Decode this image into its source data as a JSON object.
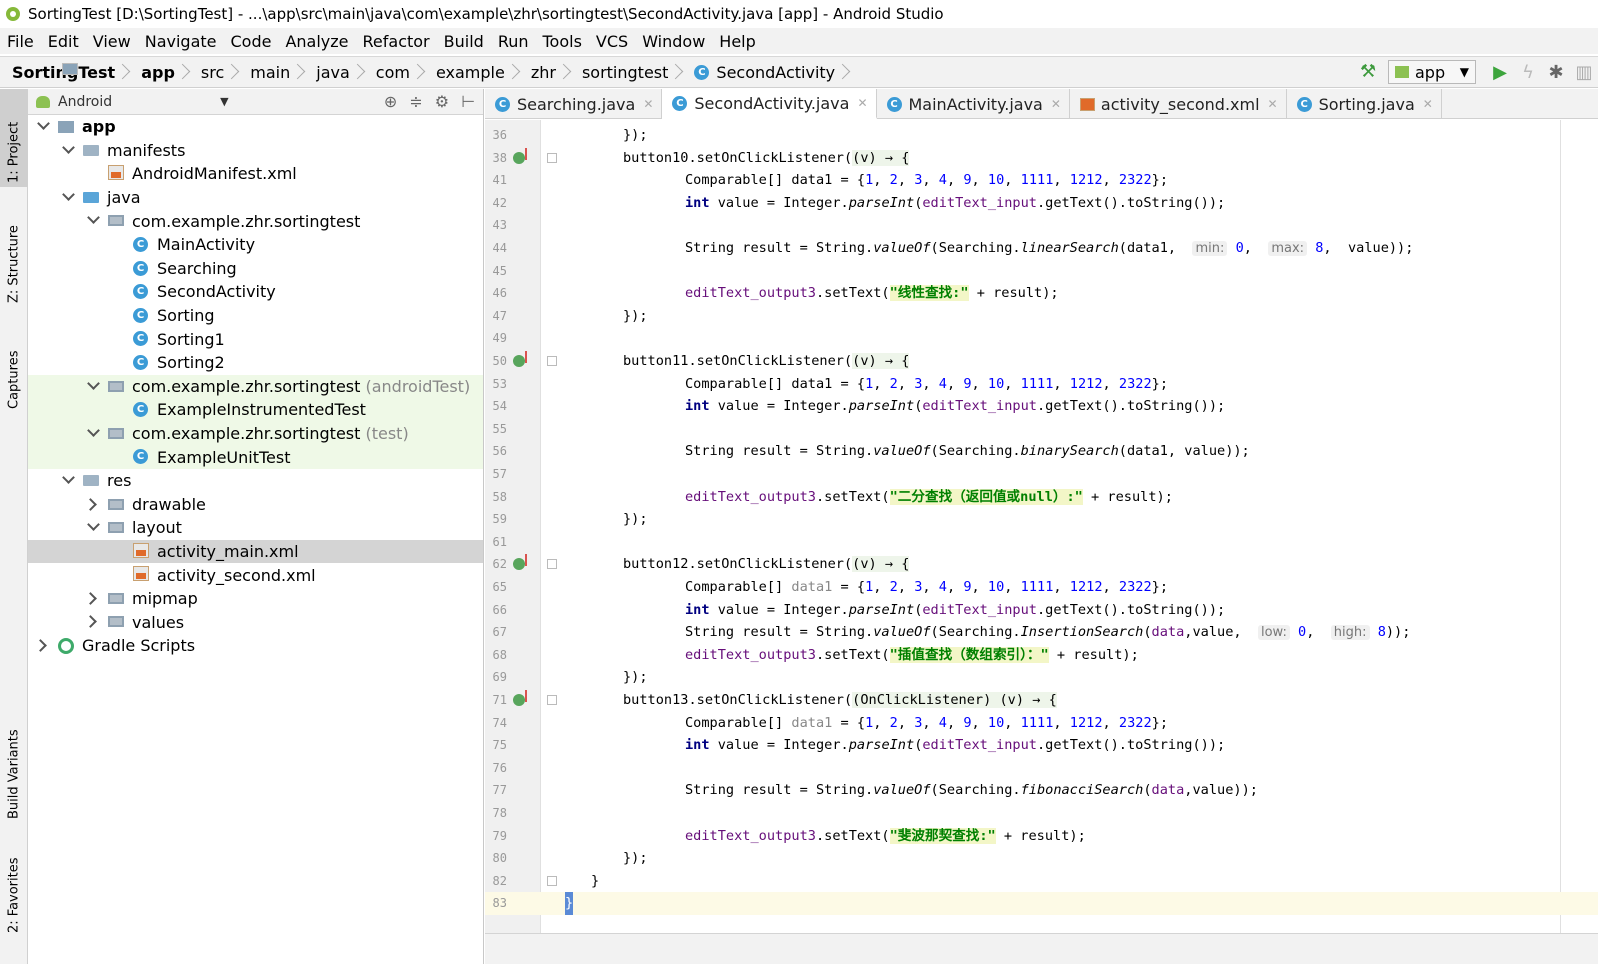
{
  "window": {
    "title": "SortingTest [D:\\SortingTest] - ...\\app\\src\\main\\java\\com\\example\\zhr\\sortingtest\\SecondActivity.java [app] - Android Studio"
  },
  "menu": [
    "File",
    "Edit",
    "View",
    "Navigate",
    "Code",
    "Analyze",
    "Refactor",
    "Build",
    "Run",
    "Tools",
    "VCS",
    "Window",
    "Help"
  ],
  "breadcrumbs": [
    "SortingTest",
    "app",
    "src",
    "main",
    "java",
    "com",
    "example",
    "zhr",
    "sortingtest",
    "SecondActivity"
  ],
  "toolbar": {
    "run_config": "app"
  },
  "side_tabs": {
    "project": "1: Project",
    "structure": "Z: Structure",
    "captures": "Captures",
    "build_variants": "Build Variants",
    "favorites": "2: Favorites"
  },
  "project_panel": {
    "view_mode": "Android"
  },
  "tree": [
    {
      "label": "app",
      "sub": "",
      "bold": true
    },
    {
      "label": "manifests",
      "sub": ""
    },
    {
      "label": "AndroidManifest.xml",
      "sub": ""
    },
    {
      "label": "java",
      "sub": ""
    },
    {
      "label": "com.example.zhr.sortingtest",
      "sub": ""
    },
    {
      "label": "MainActivity",
      "sub": ""
    },
    {
      "label": "Searching",
      "sub": ""
    },
    {
      "label": "SecondActivity",
      "sub": ""
    },
    {
      "label": "Sorting",
      "sub": ""
    },
    {
      "label": "Sorting1",
      "sub": ""
    },
    {
      "label": "Sorting2",
      "sub": ""
    },
    {
      "label": "com.example.zhr.sortingtest",
      "sub": "(androidTest)"
    },
    {
      "label": "ExampleInstrumentedTest",
      "sub": ""
    },
    {
      "label": "com.example.zhr.sortingtest",
      "sub": "(test)"
    },
    {
      "label": "ExampleUnitTest",
      "sub": ""
    },
    {
      "label": "res",
      "sub": ""
    },
    {
      "label": "drawable",
      "sub": ""
    },
    {
      "label": "layout",
      "sub": ""
    },
    {
      "label": "activity_main.xml",
      "sub": ""
    },
    {
      "label": "activity_second.xml",
      "sub": ""
    },
    {
      "label": "mipmap",
      "sub": ""
    },
    {
      "label": "values",
      "sub": ""
    },
    {
      "label": "Gradle Scripts",
      "sub": ""
    }
  ],
  "editor_tabs": [
    "Searching.java",
    "SecondActivity.java",
    "MainActivity.java",
    "activity_second.xml",
    "Sorting.java"
  ],
  "line_numbers": [
    "36",
    "38",
    "41",
    "42",
    "43",
    "44",
    "45",
    "46",
    "47",
    "49",
    "50",
    "53",
    "54",
    "55",
    "56",
    "57",
    "58",
    "59",
    "61",
    "62",
    "65",
    "66",
    "67",
    "68",
    "69",
    "71",
    "74",
    "75",
    "76",
    "77",
    "78",
    "79",
    "80",
    "82",
    "83"
  ],
  "code": {
    "l36": "});",
    "l38a": "button10.setOnClickListener(",
    "l38b": "(v) → {",
    "comparable": "Comparable[] ",
    "data1": "data1",
    "arr_eq": " = {",
    "arr_nums": [
      "1",
      "2",
      "3",
      "4",
      "9",
      "10",
      "1111",
      "1212",
      "2322"
    ],
    "arr_end": "};",
    "int_kw": "int",
    "int_rest": " value = Integer.",
    "parse": "parseInt",
    "int_tail": ".getText().toString());",
    "edit_input": "editText_input",
    "string_result": "String result = String.",
    "valueof": "valueOf",
    "searching": "(Searching.",
    "linear": "linearSearch",
    "hint_min": "min:",
    "hint_min_val": "0",
    "hint_max": "max:",
    "hint_max_val": "8",
    "linear_tail": "value));",
    "edit_output": "editText_output3",
    "settext": ".setText(",
    "str_linear": "\"线性查找:\"",
    "plus_result": " + result);",
    "close": "});",
    "l50a": "button11.setOnClickListener(",
    "binary": "binarySearch",
    "binary_tail": "(data1, value));",
    "str_binary": "\"二分查找（返回值或null）:\"",
    "l62a": "button12.setOnClickListener(",
    "insertion": "InsertionSearch",
    "data_v": "data",
    "hint_low": "low:",
    "hint_low_val": "0",
    "hint_high": "high:",
    "hint_high_val": "8",
    "str_insert": "\"插值查找（数组索引）：\"",
    "l71a": "button13.setOnClickListener(",
    "l71b": "(OnClickListener) (v) → {",
    "fib": "fibonacciSearch",
    "str_fib": "\"斐波那契查找:\"",
    "l82": "}",
    "l83": "}"
  }
}
